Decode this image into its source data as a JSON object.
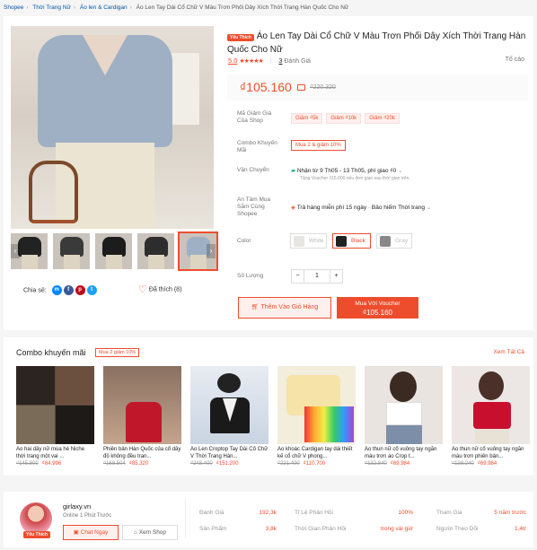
{
  "breadcrumb": [
    "Shopee",
    "Thời Trang Nữ",
    "Áo len & Cardigan",
    "Áo Len Tay Dài Cổ Chữ V Màu Trơn Phối Dây Xích Thời Trang Hàn Quốc Cho Nữ"
  ],
  "product": {
    "badge": "Yêu Thích",
    "title": "Áo Len Tay Dài Cổ Chữ V Màu Trơn Phối Dây Xích Thời Trang Hàn Quốc Cho Nữ",
    "rating": "5.0",
    "reviews_count": "3",
    "reviews_label": "Đánh Giá",
    "report": "Tố cáo",
    "price": "₫105.160",
    "old_price": "₫220.320"
  },
  "rows": {
    "voucher_label": "Mã Giảm Giá Của Shop",
    "vouchers": [
      "Giảm ₫5k",
      "Giảm ₫10k",
      "Giảm ₫20k"
    ],
    "combo_label": "Combo Khuyến Mãi",
    "combo_value": "Mua 2 & giảm 10%",
    "ship_label": "Vận Chuyển",
    "ship_line1": "Nhận từ 9 Th05 - 13 Th05, phí giao ₫0",
    "ship_line2": "Tặng Voucher ₫15.000 nếu đơn giao sau thời gian trên.",
    "secure_label": "An Tâm Mua Sắm Cùng Shopee",
    "secure_value": "Trả hàng miễn phí 15 ngày · Bảo hiểm Thời trang",
    "color_label": "Color",
    "colors": [
      "White",
      "Black",
      "Gray"
    ],
    "qty_label": "Số Lượng",
    "qty": "1",
    "add_cart": "Thêm Vào Giỏ Hàng",
    "buy_voucher": "Mua Với Voucher",
    "buy_price": "₫105.160"
  },
  "share": {
    "label": "Chia sẻ:",
    "liked": "Đã thích (8)"
  },
  "combo": {
    "title": "Combo khuyến mãi",
    "tag": "Mua 2 giảm 10%",
    "see_all": "Xem Tất Cả",
    "items": [
      {
        "name": "Áo hai dây nữ mùa hè Niche thời trang một vai ...",
        "old": "₫145.800",
        "price": "₫84.996"
      },
      {
        "name": "Phiên bản Hàn Quốc của cổ dây đỏ không đều tran...",
        "old": "₫168.504",
        "price": "₫85.320"
      },
      {
        "name": "Áo Len Croptop Tay Dài Cổ Chữ V Thời Trang Hàn...",
        "old": "₫248.400",
        "price": "₫151.200"
      },
      {
        "name": "Áo khoác Cardigan tay dài thiết kế cổ chữ V phong...",
        "old": "₫221.400",
        "price": "₫110.700"
      },
      {
        "name": "Áo thun nữ cổ vuông tay ngắn màu trơn áo Crop t...",
        "old": "₫132.840",
        "price": "₫69.984"
      },
      {
        "name": "Áo thun nữ cổ vuông tay ngắn màu trơn phiên bản...",
        "old": "₫138.240",
        "price": "₫69.984"
      }
    ]
  },
  "shop": {
    "name": "girlaxy.vn",
    "status": "Online 1 Phút Trước",
    "badge": "Yêu Thích",
    "chat": "Chat Ngay",
    "view": "Xem Shop",
    "stats": [
      {
        "k": "Đánh Giá",
        "v": "192,3k"
      },
      {
        "k": "Sản Phẩm",
        "v": "3,8k"
      },
      {
        "k": "Tỉ Lệ Phản Hồi",
        "v": "100%"
      },
      {
        "k": "Thời Gian Phản Hồi",
        "v": "trong vài giờ"
      },
      {
        "k": "Tham Gia",
        "v": "5 năm trước"
      },
      {
        "k": "Người Theo Dõi",
        "v": "1,4tr"
      }
    ]
  },
  "colors": {
    "accent": "#ee4d2d",
    "link": "#0055aa"
  }
}
